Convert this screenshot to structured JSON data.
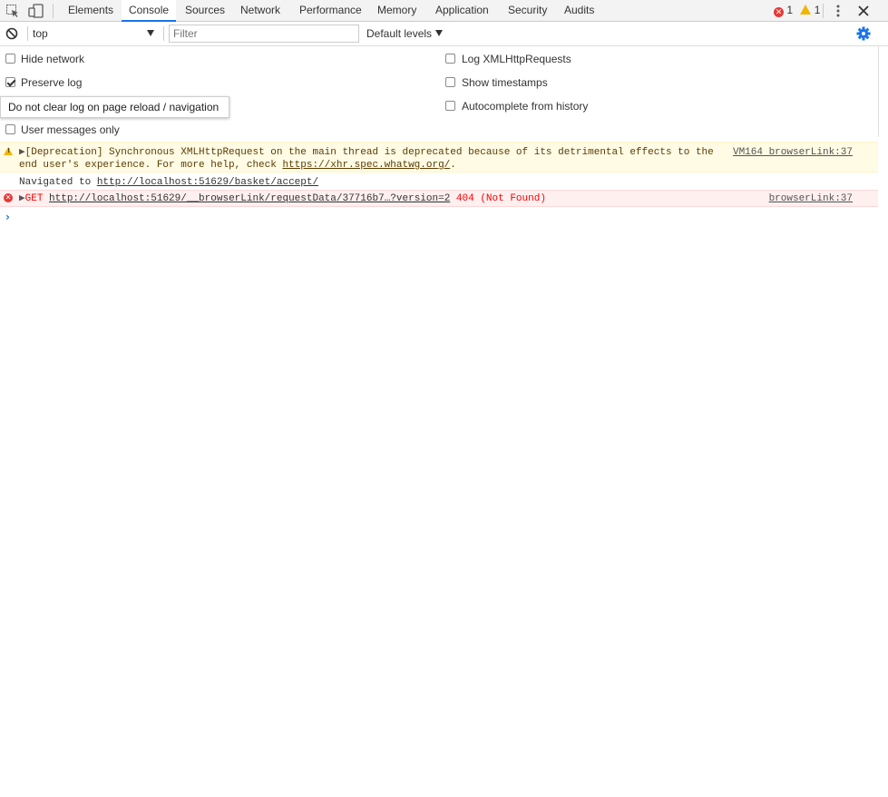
{
  "tabs": [
    {
      "label": "Elements"
    },
    {
      "label": "Console"
    },
    {
      "label": "Sources"
    },
    {
      "label": "Network"
    },
    {
      "label": "Performance"
    },
    {
      "label": "Memory"
    },
    {
      "label": "Application"
    },
    {
      "label": "Security"
    },
    {
      "label": "Audits"
    }
  ],
  "active_tab": "Console",
  "counters": {
    "errors": "1",
    "warnings": "1"
  },
  "toolbar": {
    "context": "top",
    "filter_placeholder": "Filter",
    "filter_value": "",
    "levels": "Default levels"
  },
  "settings": {
    "hide_network": {
      "label": "Hide network",
      "checked": false
    },
    "preserve_log": {
      "label": "Preserve log",
      "checked": true
    },
    "user_messages_only": {
      "label": "User messages only",
      "checked": false
    },
    "log_xhr": {
      "label": "Log XMLHttpRequests",
      "checked": false
    },
    "show_timestamps": {
      "label": "Show timestamps",
      "checked": false
    },
    "autocomplete": {
      "label": "Autocomplete from history",
      "checked": false
    }
  },
  "tooltip": "Do not clear log on page reload / navigation",
  "messages": {
    "warning": {
      "line1": "[Deprecation] Synchronous XMLHttpRequest on the main thread is deprecated because of its detrimental effects to the",
      "line2_prefix": "end user's experience. For more help, check ",
      "line2_link": "https://xhr.spec.whatwg.org/",
      "line2_suffix": ".",
      "source": "VM164 browserLink:37"
    },
    "navigated": {
      "prefix": "Navigated to ",
      "link": "http://localhost:51629/basket/accept/"
    },
    "error": {
      "method": "GET ",
      "link": "http://localhost:51629/__browserLink/requestData/37716b7…?version=2",
      "status": " 404 (Not Found)",
      "source": "browserLink:37"
    }
  },
  "prompt_symbol": "›",
  "colors": {
    "accent": "#1a73e8",
    "error": "#ff0000",
    "warning_bg": "#fffbe5",
    "error_bg": "#fff0f0",
    "warning_icon": "#f2b600"
  }
}
